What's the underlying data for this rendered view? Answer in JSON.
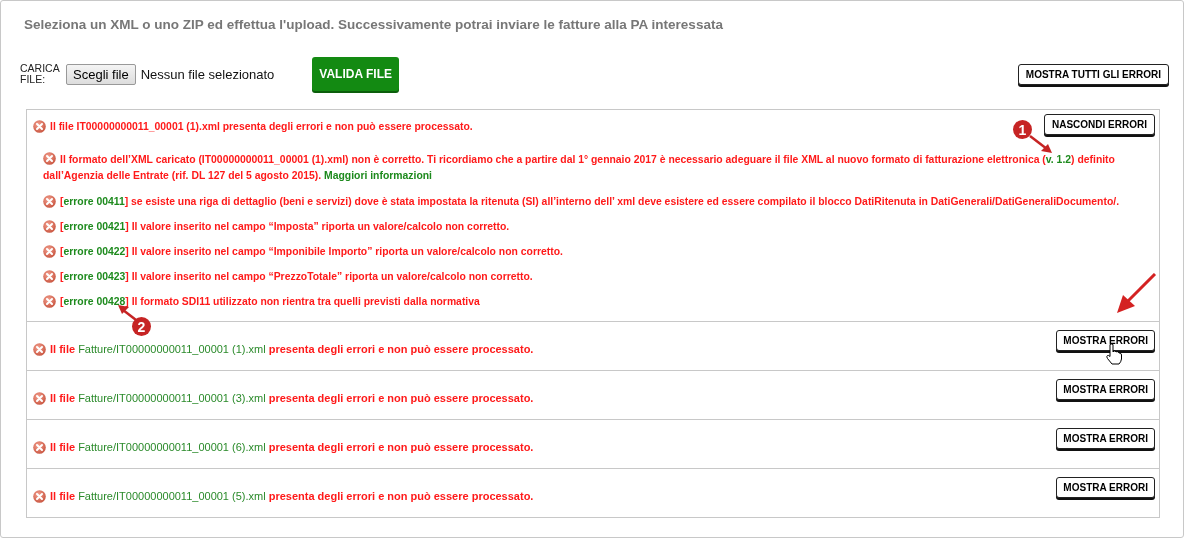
{
  "instruction": "Seleziona un XML o uno ZIP ed effettua l'upload. Successivamente potrai inviare le fatture alla PA interessata",
  "upload": {
    "label": "CARICA FILE:",
    "choose_button": "Scegli file",
    "file_status": "Nessun file selezionato",
    "validate_button": "VALIDA FILE"
  },
  "show_all_button": "MOSTRA TUTTI GLI ERRORI",
  "files": [
    {
      "expanded": true,
      "toggle_button": "NASCONDI ERRORI",
      "message": [
        {
          "kind": "error",
          "text": "Il file IT00000000011_00001 (1).xml presenta degli errori e non può essere processato."
        }
      ],
      "errors": [
        {
          "message": [
            {
              "kind": "error",
              "text": "Il formato dell’XML caricato (IT00000000011_00001 (1).xml) non è corretto. Ti ricordiamo che a partire dal 1° gennaio 2017 è necessario adeguare il file XML al nuovo formato di fatturazione elettronica ("
            },
            {
              "kind": "code",
              "text": "v. 1.2"
            },
            {
              "kind": "error",
              "text": ") definito dall’Agenzia delle Entrate (rif. DL 127 del 5 agosto 2015). "
            },
            {
              "kind": "code",
              "text": "Maggiori informazioni"
            }
          ]
        },
        {
          "message": [
            {
              "kind": "error",
              "text": "["
            },
            {
              "kind": "code",
              "text": "errore 00411"
            },
            {
              "kind": "error",
              "text": "] se esiste una riga di dettaglio (beni e servizi) dove è stata impostata la ritenuta (SI) all’interno dell’ xml deve esistere ed essere compilato il blocco DatiRitenuta in DatiGenerali/DatiGeneraliDocumento/."
            }
          ]
        },
        {
          "message": [
            {
              "kind": "error",
              "text": "["
            },
            {
              "kind": "code",
              "text": "errore 00421"
            },
            {
              "kind": "error",
              "text": "] Il valore inserito nel campo “Imposta” riporta un valore/calcolo non corretto."
            }
          ]
        },
        {
          "message": [
            {
              "kind": "error",
              "text": "["
            },
            {
              "kind": "code",
              "text": "errore 00422"
            },
            {
              "kind": "error",
              "text": "] Il valore inserito nel campo “Imponibile Importo” riporta un valore/calcolo non corretto."
            }
          ]
        },
        {
          "message": [
            {
              "kind": "error",
              "text": "["
            },
            {
              "kind": "code",
              "text": "errore 00423"
            },
            {
              "kind": "error",
              "text": "] Il valore inserito nel campo “PrezzoTotale” riporta un valore/calcolo non corretto."
            }
          ]
        },
        {
          "message": [
            {
              "kind": "error",
              "text": "["
            },
            {
              "kind": "code",
              "text": "errore 00428"
            },
            {
              "kind": "error",
              "text": "] Il formato SDI11 utilizzato non rientra tra quelli previsti dalla normativa"
            }
          ]
        }
      ]
    },
    {
      "expanded": false,
      "toggle_button": "MOSTRA ERRORI",
      "message": [
        {
          "kind": "error",
          "text": "Il file "
        },
        {
          "kind": "path",
          "text": "Fatture/IT00000000011_00001 (1).xml"
        },
        {
          "kind": "error",
          "text": " presenta degli errori e non può essere processato."
        }
      ]
    },
    {
      "expanded": false,
      "toggle_button": "MOSTRA ERRORI",
      "message": [
        {
          "kind": "error",
          "text": "Il file "
        },
        {
          "kind": "path",
          "text": "Fatture/IT00000000011_00001 (3).xml"
        },
        {
          "kind": "error",
          "text": " presenta degli errori e non può essere processato."
        }
      ]
    },
    {
      "expanded": false,
      "toggle_button": "MOSTRA ERRORI",
      "message": [
        {
          "kind": "error",
          "text": "Il file "
        },
        {
          "kind": "path",
          "text": "Fatture/IT00000000011_00001 (6).xml"
        },
        {
          "kind": "error",
          "text": " presenta degli errori e non può essere processato."
        }
      ]
    },
    {
      "expanded": false,
      "toggle_button": "MOSTRA ERRORI",
      "message": [
        {
          "kind": "error",
          "text": "Il file "
        },
        {
          "kind": "path",
          "text": "Fatture/IT00000000011_00001 (5).xml"
        },
        {
          "kind": "error",
          "text": " presenta degli errori e non può essere processato."
        }
      ]
    }
  ],
  "callouts": [
    {
      "number": "1"
    },
    {
      "number": "2"
    }
  ]
}
